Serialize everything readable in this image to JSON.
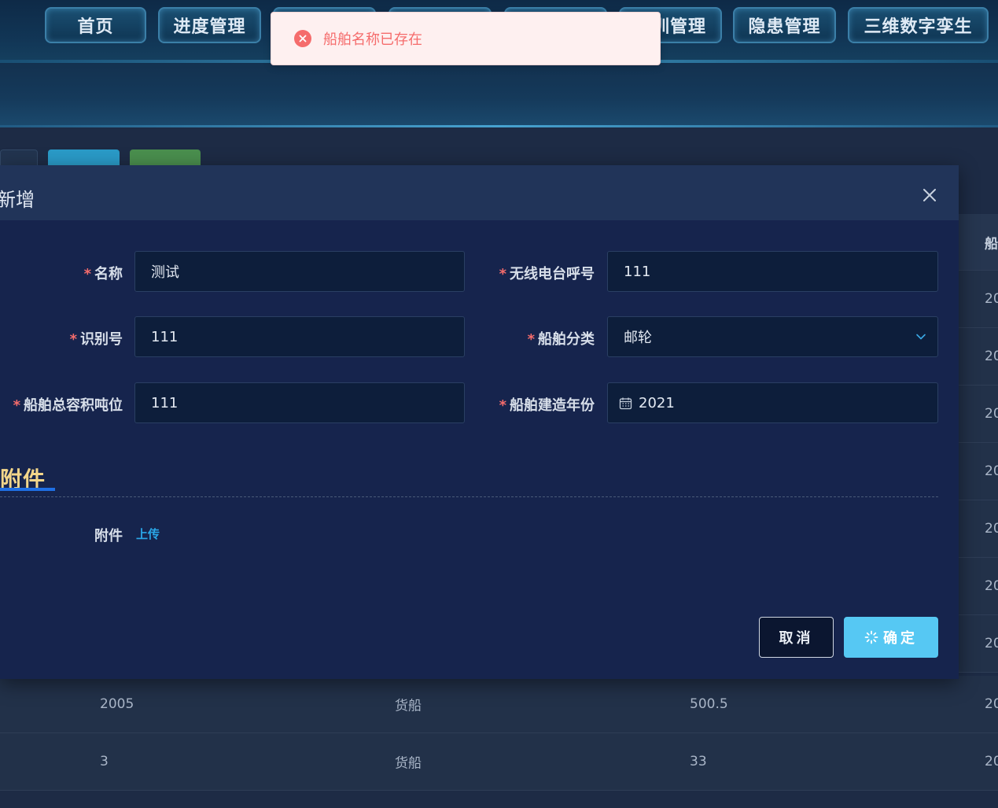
{
  "nav": {
    "items": [
      {
        "label": "首页"
      },
      {
        "label": "进度管理"
      },
      {
        "label": ""
      },
      {
        "label": ""
      },
      {
        "label": ""
      },
      {
        "label": "训管理"
      },
      {
        "label": "隐患管理"
      },
      {
        "label": "三维数字孪生"
      }
    ]
  },
  "table": {
    "header_right_cut": "船",
    "right_col_values": [
      "20",
      "20",
      "20",
      "20",
      "20",
      "20",
      "20"
    ],
    "rows": [
      {
        "c1": "2005",
        "c2": "货船",
        "c3": "500.5",
        "c4": "20"
      },
      {
        "c1": "3",
        "c2": "货船",
        "c3": "33",
        "c4": "20"
      }
    ]
  },
  "dialog": {
    "title": "新增",
    "fields": {
      "name": {
        "label": "名称",
        "value": "测试",
        "required_mark": "*"
      },
      "radio_call": {
        "label": "无线电台呼号",
        "value": "111",
        "required_mark": "*"
      },
      "id_number": {
        "label": "识别号",
        "value": "111",
        "required_mark": "*"
      },
      "ship_type": {
        "label": "船舶分类",
        "value": "邮轮",
        "required_mark": "*"
      },
      "gross_tonnage": {
        "label": "船舶总容积吨位",
        "value": "111",
        "required_mark": "*"
      },
      "build_year": {
        "label": "船舶建造年份",
        "value": "2021",
        "required_mark": "*"
      }
    },
    "attachments": {
      "section_title": "附件",
      "label": "附件",
      "upload_label": "上传"
    },
    "buttons": {
      "cancel": "取消",
      "confirm": "确定"
    }
  },
  "toast": {
    "type": "error",
    "message": "船舶名称已存在"
  },
  "colors": {
    "accent": "#56c8f3",
    "error": "#f56c6c",
    "section_title": "#f3d68a",
    "link": "#2aa7e8"
  }
}
